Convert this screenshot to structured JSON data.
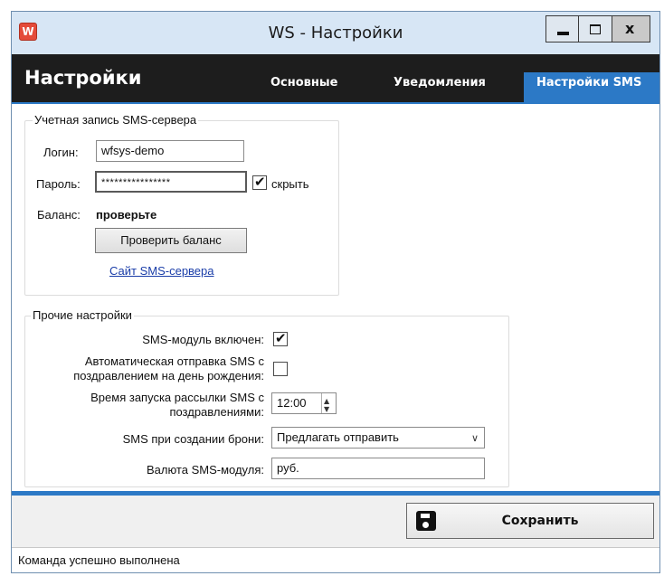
{
  "window": {
    "title": "WS - Настройки",
    "icon_letter": "W",
    "controls": {
      "minimize": "minimize-icon",
      "maximize": "maximize-icon",
      "close": "x"
    }
  },
  "header": {
    "title": "Настройки",
    "tabs": [
      {
        "label": "Основные",
        "active": false
      },
      {
        "label": "Уведомления",
        "active": false
      },
      {
        "label": "Настройки SMS",
        "active": true
      }
    ]
  },
  "account": {
    "group_title": "Учетная запись SMS-сервера",
    "login_label": "Логин:",
    "login_value": "wfsys-demo",
    "password_label": "Пароль:",
    "password_value": "****************",
    "hide_label": "скрыть",
    "hide_checked": true,
    "balance_label": "Баланс:",
    "balance_value": "проверьте",
    "check_balance_button": "Проверить баланс",
    "server_link": "Сайт SMS-сервера"
  },
  "other": {
    "group_title": "Прочие настройки",
    "sms_enabled_label": "SMS-модуль включен:",
    "sms_enabled_checked": true,
    "birthday_label_line1": "Автоматическая отправка SMS с",
    "birthday_label_line2": "поздравлением на день рождения:",
    "birthday_checked": false,
    "send_time_label_line1": "Время запуска рассылки SMS с",
    "send_time_label_line2": "поздравлениями:",
    "send_time_value": "12:00",
    "booking_label": "SMS при создании брони:",
    "booking_value": "Предлагать отправить",
    "currency_label": "Валюта SMS-модуля:",
    "currency_value": "руб."
  },
  "footer": {
    "save_button": "Сохранить",
    "status": "Команда успешно выполнена"
  },
  "colors": {
    "accent": "#2c79c6",
    "header_bg": "#1d1d1d",
    "titlebar_bg": "#d7e6f5",
    "link": "#1a3da8"
  }
}
